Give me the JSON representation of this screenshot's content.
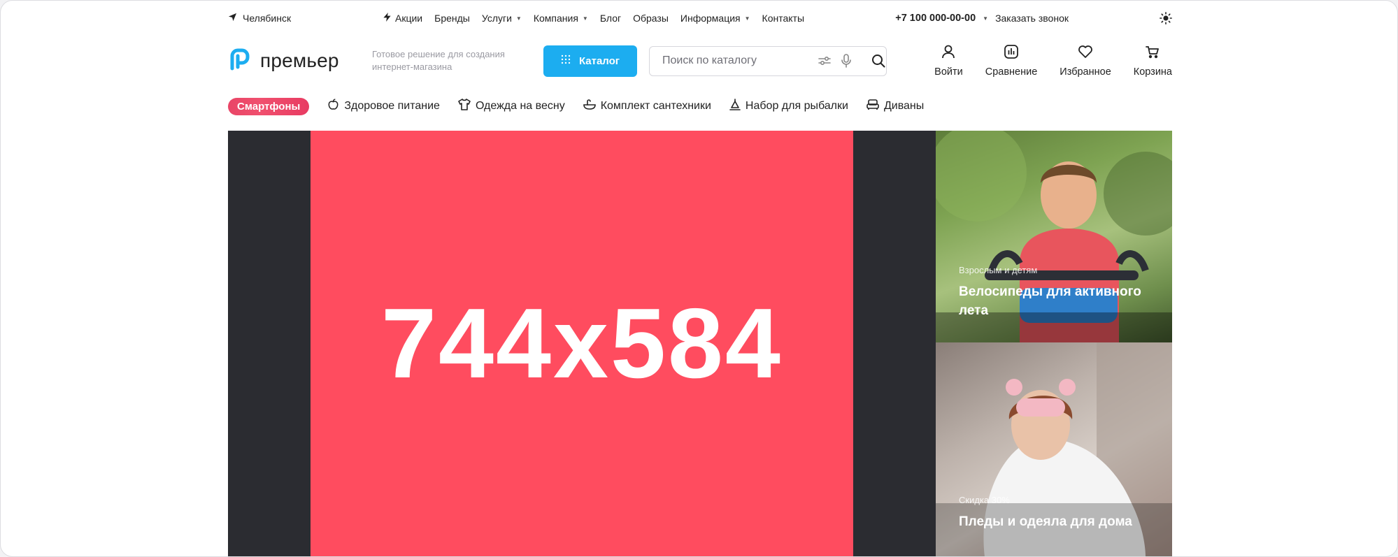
{
  "topbar": {
    "city": "Челябинск",
    "nav": [
      {
        "label": "Акции",
        "icon": "lightning-icon",
        "dropdown": false
      },
      {
        "label": "Бренды",
        "dropdown": false
      },
      {
        "label": "Услуги",
        "dropdown": true
      },
      {
        "label": "Компания",
        "dropdown": true
      },
      {
        "label": "Блог",
        "dropdown": false
      },
      {
        "label": "Образы",
        "dropdown": false
      },
      {
        "label": "Информация",
        "dropdown": true
      },
      {
        "label": "Контакты",
        "dropdown": false
      }
    ],
    "phone": "+7 100 000-00-00",
    "callback": "Заказать звонок"
  },
  "header": {
    "logo_text": "премьер",
    "slogan": "Готовое решение для создания интернет-магазина",
    "catalog_label": "Каталог",
    "search_placeholder": "Поиск по каталогу",
    "actions": {
      "login": "Войти",
      "compare": "Сравнение",
      "favorites": "Избранное",
      "cart": "Корзина"
    }
  },
  "quick_links": {
    "chip": "Смартфоны",
    "items": [
      "Здоровое питание",
      "Одежда на весну",
      "Комплект сантехники",
      "Набор для рыбалки",
      "Диваны"
    ]
  },
  "banner": {
    "main_text": "744x584",
    "side": [
      {
        "subtitle": "Взрослым и детям",
        "title": "Велосипеды для активного лета"
      },
      {
        "subtitle": "Скидка 30%",
        "title": "Пледы и одеяла для дома"
      }
    ]
  },
  "colors": {
    "accent": "#1cadf0",
    "banner_pink": "#ff4c5f",
    "banner_dark": "#2b2c31",
    "chip": "#f0506e"
  }
}
